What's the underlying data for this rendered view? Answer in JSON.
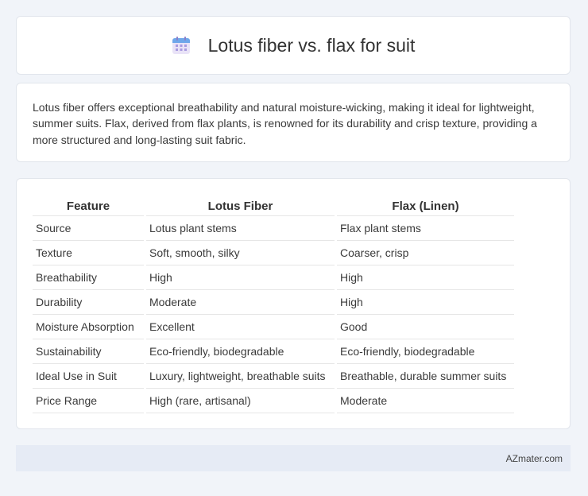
{
  "header": {
    "title": "Lotus fiber vs. flax for suit",
    "icon": "calendar-icon"
  },
  "intro": {
    "text": "Lotus fiber offers exceptional breathability and natural moisture-wicking, making it ideal for lightweight, summer suits. Flax, derived from flax plants, is renowned for its durability and crisp texture, providing a more structured and long-lasting suit fabric."
  },
  "table": {
    "headers": [
      "Feature",
      "Lotus Fiber",
      "Flax (Linen)"
    ],
    "rows": [
      [
        "Source",
        "Lotus plant stems",
        "Flax plant stems"
      ],
      [
        "Texture",
        "Soft, smooth, silky",
        "Coarser, crisp"
      ],
      [
        "Breathability",
        "High",
        "High"
      ],
      [
        "Durability",
        "Moderate",
        "High"
      ],
      [
        "Moisture Absorption",
        "Excellent",
        "Good"
      ],
      [
        "Sustainability",
        "Eco-friendly, biodegradable",
        "Eco-friendly, biodegradable"
      ],
      [
        "Ideal Use in Suit",
        "Luxury, lightweight, breathable suits",
        "Breathable, durable summer suits"
      ],
      [
        "Price Range",
        "High (rare, artisanal)",
        "Moderate"
      ]
    ]
  },
  "footer": {
    "site": "AZmater.com"
  }
}
